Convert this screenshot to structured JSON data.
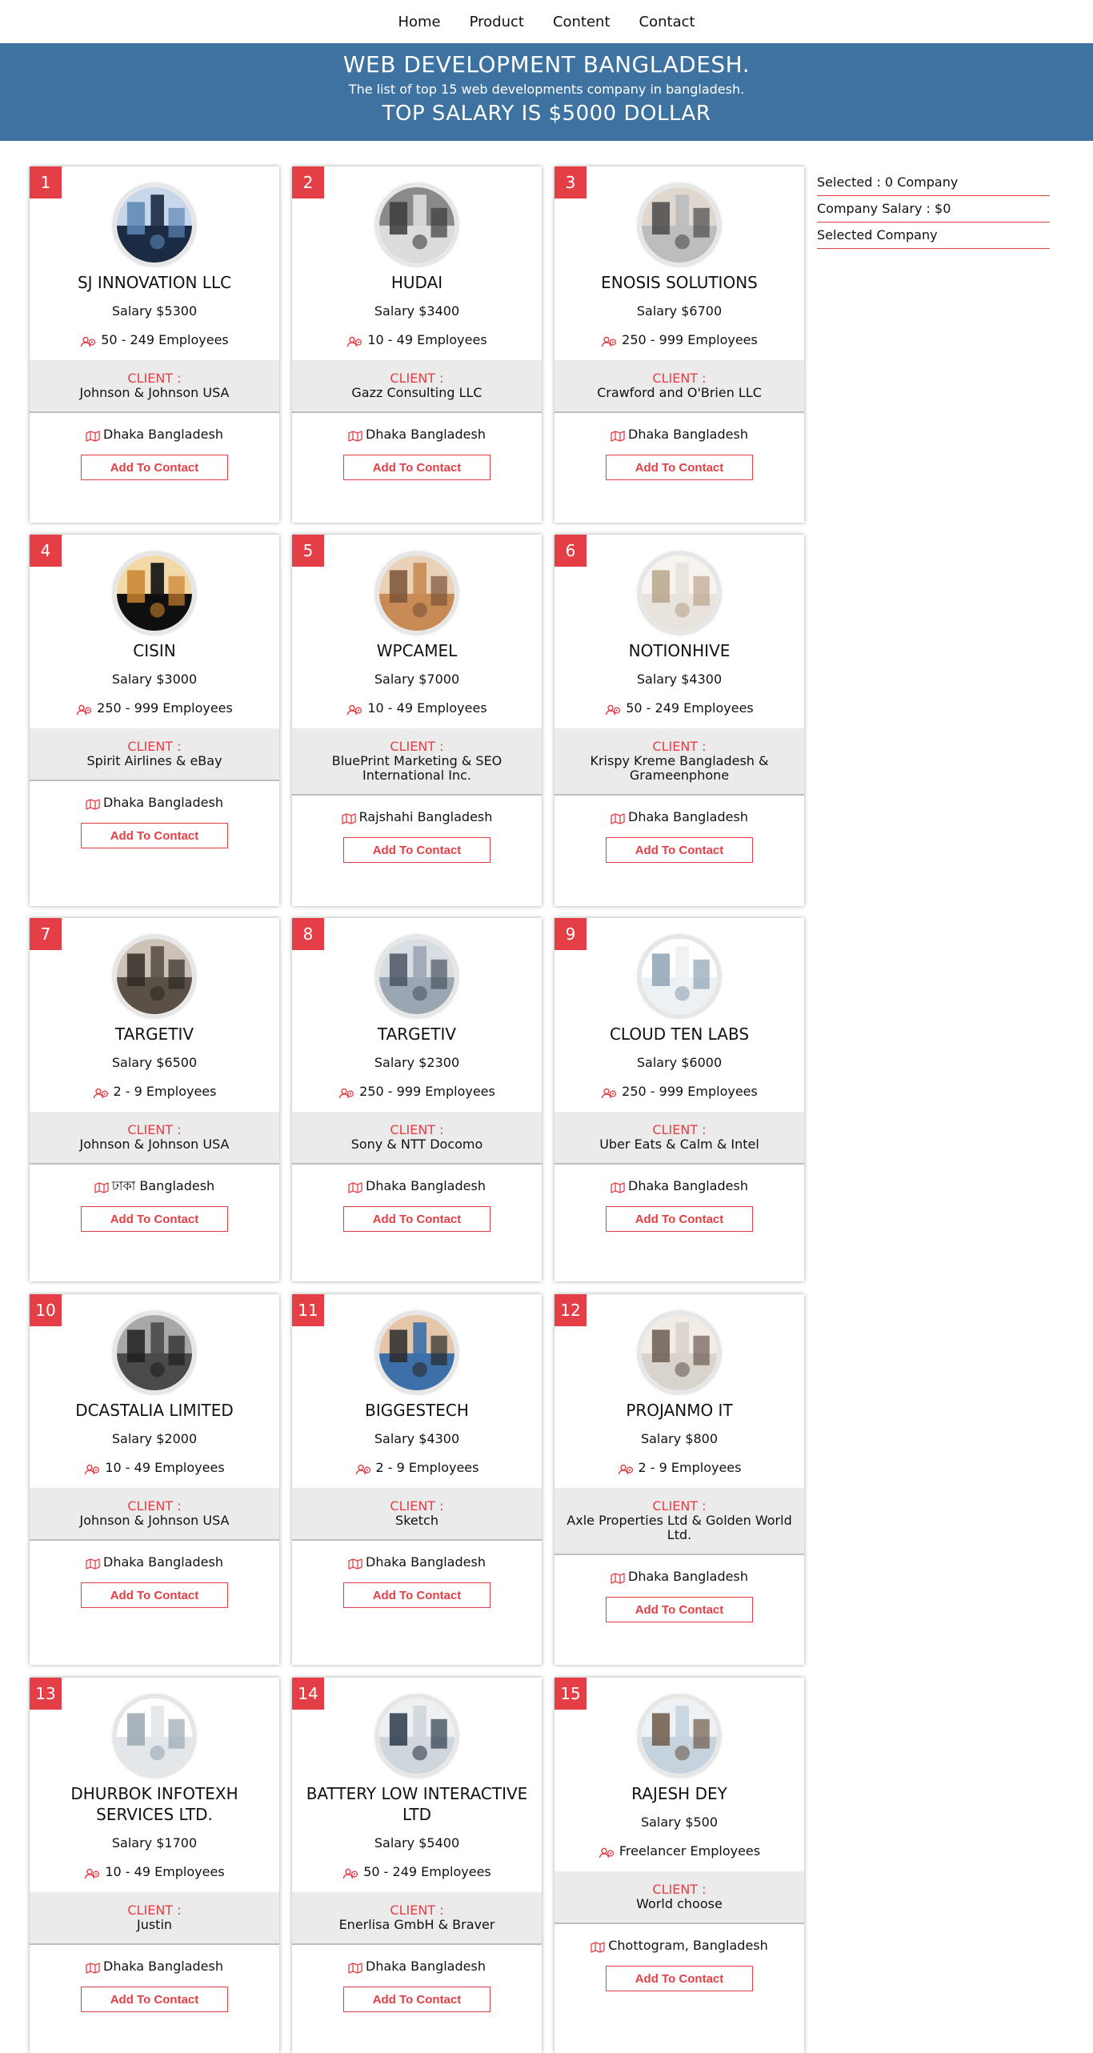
{
  "nav": {
    "home": "Home",
    "product": "Product",
    "content": "Content",
    "contact": "Contact"
  },
  "banner": {
    "title": "WEB DEVELOPMENT BANGLADESH.",
    "subtitle": "The list of top 15 web developments company in bangladesh.",
    "salary_line": "TOP SALARY IS $5000 DOLLAR"
  },
  "sidebar": {
    "selected": "Selected : 0 Company",
    "company_salary": "Company Salary : $0",
    "selected_company": "Selected Company"
  },
  "colors": {
    "accent": "#e43f46",
    "banner": "#3e72a1"
  },
  "client_label": "CLIENT :",
  "button_label": "Add To Contact",
  "companies": [
    {
      "num": "1",
      "name": "SJ INNOVATION LLC",
      "salary": "Salary $5300",
      "employees": "50 - 249 Employees",
      "client": "Johnson & Johnson USA",
      "location": "Dhaka Bangladesh",
      "image": "buildings-photo",
      "icon_colors": [
        "#1b2b44",
        "#5c87b5",
        "#c8d8ea"
      ]
    },
    {
      "num": "2",
      "name": "HUDAI",
      "salary": "Salary $3400",
      "employees": "10 - 49 Employees",
      "client": "Gazz Consulting LLC",
      "location": "Dhaka Bangladesh",
      "image": "laptop-desk-photo",
      "icon_colors": [
        "#dcdcdc",
        "#3b3b3b",
        "#8a8a8a"
      ]
    },
    {
      "num": "3",
      "name": "ENOSIS SOLUTIONS",
      "salary": "Salary $6700",
      "employees": "250 - 999 Employees",
      "client": "Crawford and O'Brien LLC",
      "location": "Dhaka Bangladesh",
      "image": "office-desk-photo",
      "icon_colors": [
        "#bdbdbd",
        "#4a4a4a",
        "#e0d8cf"
      ]
    },
    {
      "num": "4",
      "name": "CISIN",
      "salary": "Salary $3000",
      "employees": "250 - 999 Employees",
      "client": "Spirit Airlines & eBay",
      "location": "Dhaka Bangladesh",
      "image": "tech-hand-photo",
      "icon_colors": [
        "#0f0f10",
        "#c9822f",
        "#f4d9a8"
      ]
    },
    {
      "num": "5",
      "name": "WPCAMEL",
      "salary": "Salary $7000",
      "employees": "10 - 49 Employees",
      "client": "BluePrint Marketing & SEO International Inc.",
      "location": "Rajshahi Bangladesh",
      "image": "team-hands-photo",
      "icon_colors": [
        "#c98b56",
        "#7b5338",
        "#e9d2b7"
      ]
    },
    {
      "num": "6",
      "name": "NOTIONHIVE",
      "salary": "Salary $4300",
      "employees": "50 - 249 Employees",
      "client": "Krispy Kreme Bangladesh & Grameenphone",
      "location": "Dhaka Bangladesh",
      "image": "workspace-photo",
      "icon_colors": [
        "#e8e3dc",
        "#b9a48c",
        "#f7f3ee"
      ]
    },
    {
      "num": "7",
      "name": "TARGETIV",
      "salary": "Salary $6500",
      "employees": "2 - 9 Employees",
      "client": "Johnson & Johnson USA",
      "location": "ঢাকা Bangladesh",
      "image": "meeting-room-photo",
      "icon_colors": [
        "#5b5046",
        "#2f2a25",
        "#cdc2b6"
      ]
    },
    {
      "num": "8",
      "name": "TARGETIV",
      "salary": "Salary $2300",
      "employees": "250 - 999 Employees",
      "client": "Sony & NTT Docomo",
      "location": "Dhaka Bangladesh",
      "image": "office-team-photo",
      "icon_colors": [
        "#9aa6b2",
        "#4b5663",
        "#d9dee3"
      ]
    },
    {
      "num": "9",
      "name": "CLOUD TEN LABS",
      "salary": "Salary $6000",
      "employees": "250 - 999 Employees",
      "client": "Uber Eats & Calm & Intel",
      "location": "Dhaka Bangladesh",
      "image": "bright-office-photo",
      "icon_colors": [
        "#eef1f3",
        "#8fa3b3",
        "#ffffff"
      ]
    },
    {
      "num": "10",
      "name": "DCASTALIA LIMITED",
      "salary": "Salary $2000",
      "employees": "10 - 49 Employees",
      "client": "Johnson & Johnson USA",
      "location": "Dhaka Bangladesh",
      "image": "lobby-photo",
      "icon_colors": [
        "#4a4a4a",
        "#1f1f1f",
        "#a8a8a8"
      ]
    },
    {
      "num": "11",
      "name": "BIGGESTECH",
      "salary": "Salary $4300",
      "employees": "2 - 9 Employees",
      "client": "Sketch",
      "location": "Dhaka Bangladesh",
      "image": "coworkers-photo",
      "icon_colors": [
        "#3d6fa8",
        "#2a2a2a",
        "#e5c6a8"
      ]
    },
    {
      "num": "12",
      "name": "PROJANMO IT",
      "salary": "Salary $800",
      "employees": "2 - 9 Employees",
      "client": "Axle Properties Ltd & Golden World Ltd.",
      "location": "Dhaka Bangladesh",
      "image": "papers-desk-photo",
      "icon_colors": [
        "#d9d3cd",
        "#6b5d51",
        "#f1ece6"
      ]
    },
    {
      "num": "13",
      "name": "DHURBOK INFOTEXH SERVICES LTD.",
      "salary": "Salary $1700",
      "employees": "10 - 49 Employees",
      "client": "Justin",
      "location": "Dhaka Bangladesh",
      "image": "window-office-photo",
      "icon_colors": [
        "#e3e7ea",
        "#9aa7b1",
        "#ffffff"
      ]
    },
    {
      "num": "14",
      "name": "BATTERY LOW INTERACTIVE LTD",
      "salary": "Salary $5400",
      "employees": "50 - 249 Employees",
      "client": "Enerlisa GmbH & Braver",
      "location": "Dhaka Bangladesh",
      "image": "meeting-table-photo",
      "icon_colors": [
        "#cfd6dc",
        "#2d3a4a",
        "#eef0f2"
      ]
    },
    {
      "num": "15",
      "name": "RAJESH DEY",
      "salary": "Salary $500",
      "employees": "Freelancer Employees",
      "client": "World choose",
      "location": "Chottogram, Bangladesh",
      "image": "lounge-photo",
      "icon_colors": [
        "#c5d3de",
        "#6d5a49",
        "#eef2f5"
      ]
    }
  ]
}
